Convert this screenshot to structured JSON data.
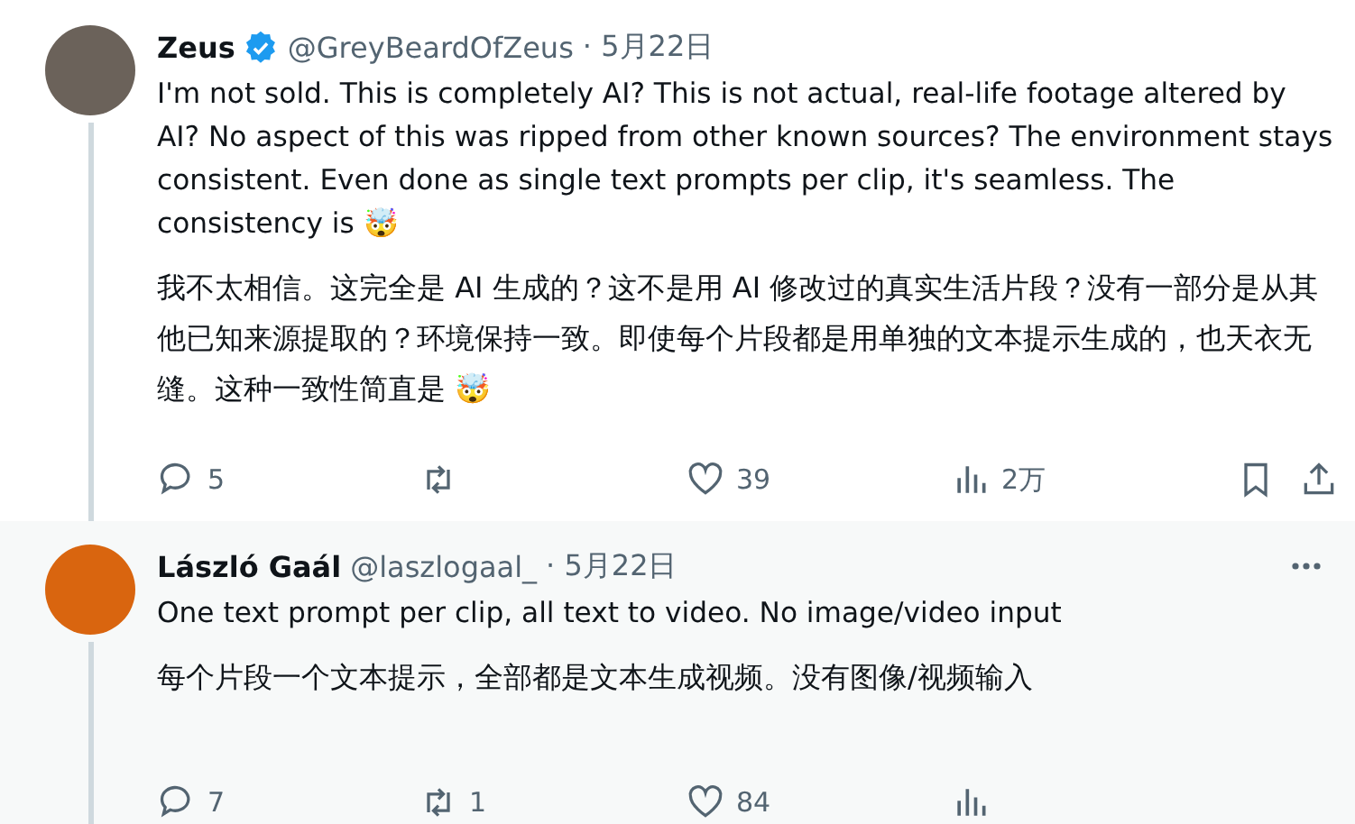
{
  "tweets": [
    {
      "name": "Zeus",
      "verified": true,
      "handle": "@GreyBeardOfZeus",
      "date": "· 5月22日",
      "highlighted": false,
      "thread_line": true,
      "more_menu": false,
      "text": "I'm not sold. This is completely AI? This is not actual, real-life footage altered by AI? No aspect of this was ripped from other known sources? The environment stays consistent. Even done as single text prompts per clip, it's seamless. The consistency is 🤯",
      "translation": "我不太相信。这完全是 AI 生成的？这不是用 AI 修改过的真实生活片段？没有一部分是从其他已知来源提取的？环境保持一致。即使每个片段都是用单独的文本提示生成的，也天衣无缝。这种一致性简直是 🤯",
      "actions": [
        {
          "kind": "reply",
          "count": "5"
        },
        {
          "kind": "repost"
        },
        {
          "kind": "like",
          "count": "39"
        },
        {
          "kind": "views",
          "count": "2万"
        },
        {
          "kind": "bookmark"
        },
        {
          "kind": "share"
        }
      ]
    },
    {
      "name": "László Gaál",
      "verified": false,
      "handle": "@laszlogaal_",
      "date": "· 5月22日",
      "highlighted": true,
      "thread_line": true,
      "more_menu": true,
      "text": "One text prompt per clip, all text to video. No image/video input",
      "translation": "每个片段一个文本提示，全部都是文本生成视频。没有图像/视频输入",
      "actions": [
        {
          "kind": "reply",
          "count": "7"
        },
        {
          "kind": "repost",
          "count": "1"
        },
        {
          "kind": "like",
          "count": "84"
        },
        {
          "kind": "views"
        }
      ]
    }
  ]
}
